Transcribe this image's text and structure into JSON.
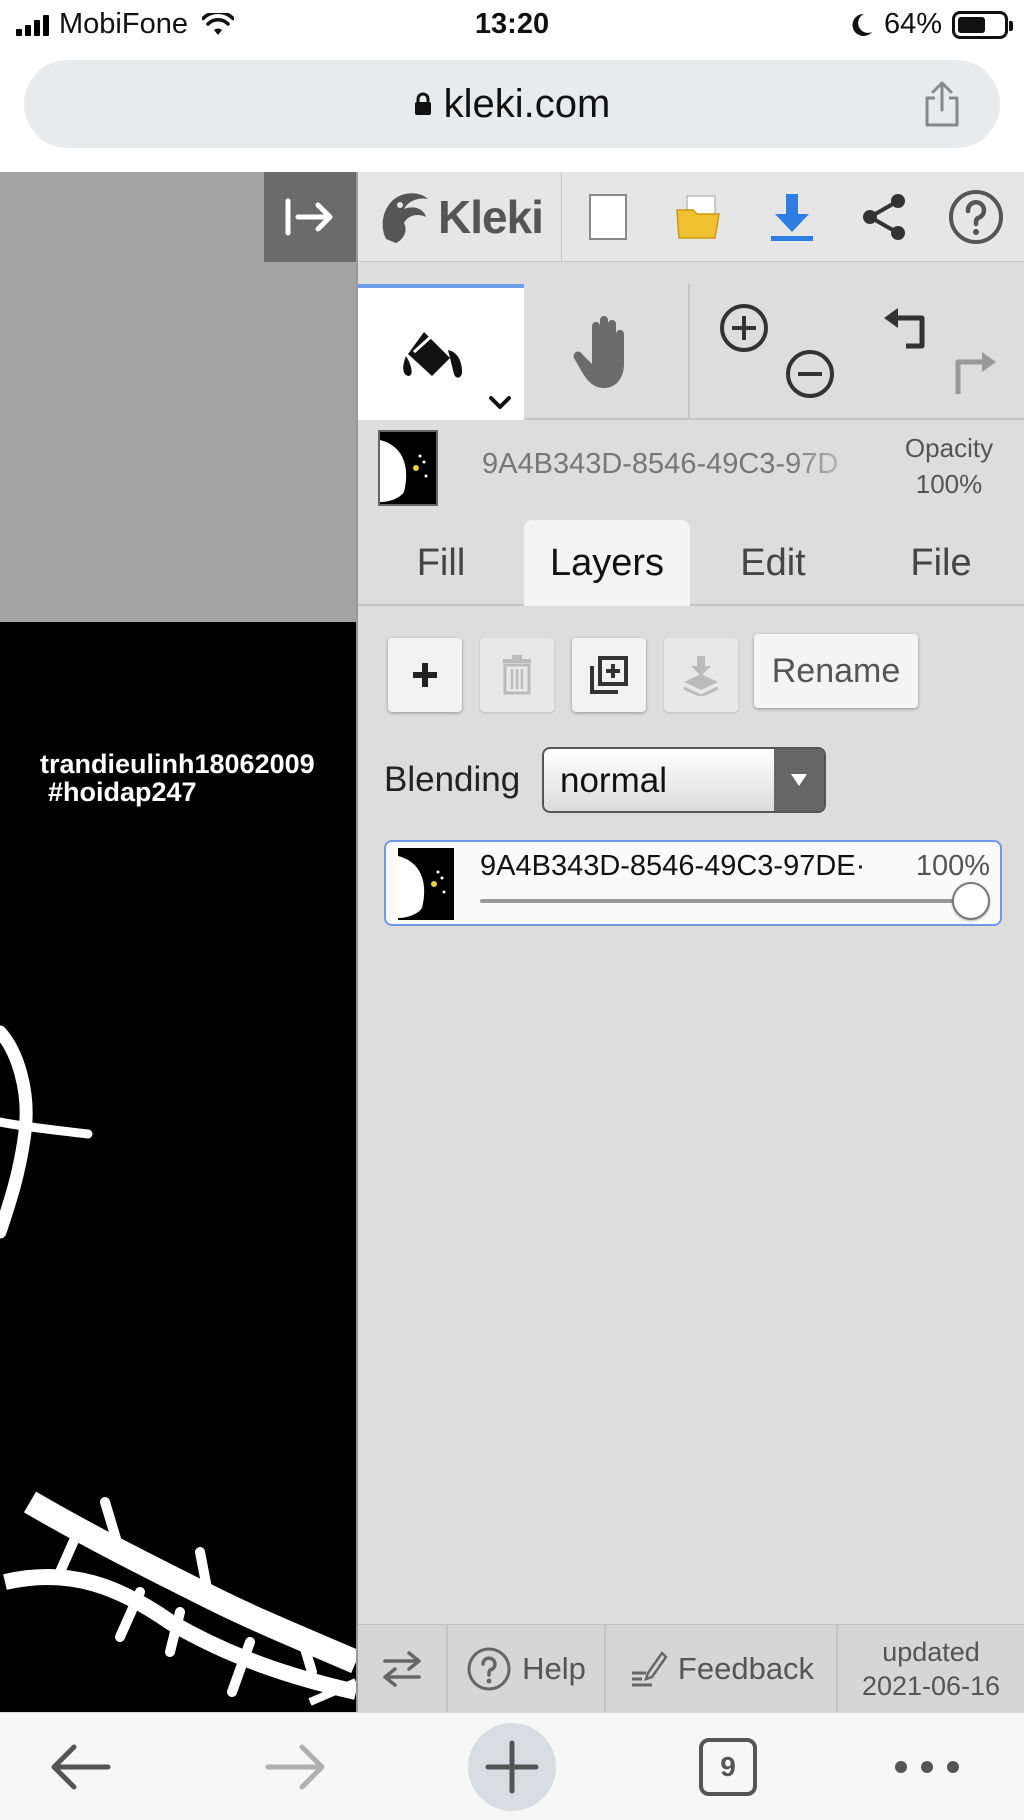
{
  "status_bar": {
    "carrier": "MobiFone",
    "time": "13:20",
    "battery": "64%",
    "battery_level": 0.64,
    "icons": [
      "signal-icon",
      "wifi-icon",
      "moon-icon",
      "battery-icon"
    ]
  },
  "browser": {
    "url": "kleki.com",
    "icons": [
      "lock-icon",
      "share-icon"
    ],
    "open_tabs": "9"
  },
  "canvas": {
    "text_line1": "trandieulinh18062009",
    "text_line2": "#hoidap247"
  },
  "app": {
    "logo_text": "Kleki",
    "topbar_icons": [
      "new-document-icon",
      "open-folder-icon",
      "download-icon",
      "share-icon",
      "help-icon"
    ],
    "tools": [
      "paint-bucket-icon",
      "hand-icon",
      "zoom-in-icon",
      "zoom-out-icon",
      "undo-icon",
      "redo-icon"
    ],
    "active_layer": {
      "name": "9A4B343D-8546-49C3-97D",
      "opacity_label": "Opacity",
      "opacity_value": "100%"
    },
    "tabs": [
      "Fill",
      "Layers",
      "Edit",
      "File"
    ],
    "active_tab": "Layers",
    "layer_actions": {
      "rename_label": "Rename",
      "icons": [
        "add-layer-icon",
        "delete-layer-icon",
        "duplicate-layer-icon",
        "merge-down-icon"
      ]
    },
    "blending": {
      "label": "Blending",
      "value": "normal"
    },
    "layers": [
      {
        "name": "9A4B343D-8546-49C3-97DE·",
        "opacity": "100%",
        "opacity_fraction": 1.0
      }
    ],
    "footer": {
      "help": "Help",
      "feedback": "Feedback",
      "updated_line1": "updated",
      "updated_line2": "2021-06-16"
    }
  },
  "colors": {
    "accent_blue": "#6e9ce8",
    "download_blue": "#2f7de1",
    "folder_yellow": "#f0c232",
    "panel_bg": "#dddddd"
  }
}
